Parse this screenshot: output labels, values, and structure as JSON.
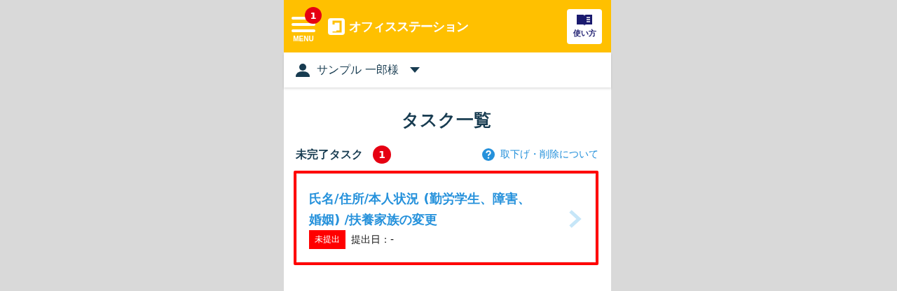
{
  "header": {
    "menu_label": "MENU",
    "menu_badge": "1",
    "logo_text": "オフィスステーション",
    "help_button": "使い方"
  },
  "user": {
    "name": "サンプル 一郎様"
  },
  "page_title": "タスク一覧",
  "section": {
    "title": "未完了タスク",
    "count": "1",
    "help_link": "取下げ・削除について"
  },
  "tasks": [
    {
      "title": "氏名/住所/本人状況 (勤労学生、障害、婚姻) /扶養家族の変更",
      "status": "未提出",
      "submitted": "提出日：-",
      "highlighted": true
    }
  ]
}
